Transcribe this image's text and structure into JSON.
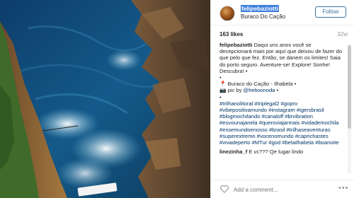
{
  "post": {
    "username": "felipebaziotti",
    "location": "Buraco Do Cação",
    "follow_label": "Follow",
    "likes": "163 likes",
    "time": "32w"
  },
  "caption": {
    "user": "felipebaziotti",
    "text": "Daqui uns anos você se decepcionará mais por aquí que deixou de fazer do que pelo que fez. Então, se danem os limites! Saia do porto seguro. Aventure-se! Explore! Sonhe! Descubra! •",
    "dot": "•",
    "location_line": "📍 Buraco do Cação - Ilhabela •",
    "credit_prefix": "📷 pic by ",
    "credit_handle": "@helioonoda",
    "credit_suffix": " •",
    "dot2": "•",
    "hashtags": "#trilhanolitoral #triplegal2 #gopro #vibepositivamundo #instagram #igersbrasil #blogmochilando #canaloff #brvibration #euvounajanela #queroviajarmais #vidademochila #essemundoenosso #brasil #trilhaseaventuras #superextremo #vocenomundo #caprichastes #vivadeperto #MTur #god #belailhabela #boanoite"
  },
  "comment": {
    "user": "linezinha_f",
    "text": "E vc??? Qe lugar lindo"
  },
  "add_comment": {
    "placeholder": "Add a comment...",
    "more": "•••"
  },
  "colors": {
    "link": "#003569",
    "follow": "#3f729b",
    "selection": "#3b7ddd"
  }
}
